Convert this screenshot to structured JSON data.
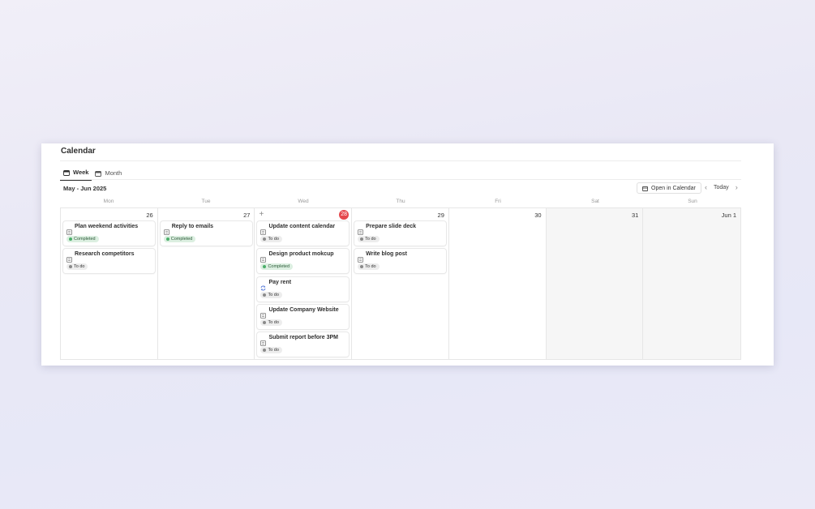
{
  "title": "Calendar",
  "tabs": [
    {
      "label": "Week",
      "icon": "calendar-icon",
      "active": true
    },
    {
      "label": "Month",
      "icon": "calendar-icon",
      "active": false
    }
  ],
  "range_label": "May - Jun 2025",
  "open_button": "Open in Calendar",
  "today_button": "Today",
  "weekdays": [
    "Mon",
    "Tue",
    "Wed",
    "Thu",
    "Fri",
    "Sat",
    "Sun"
  ],
  "days": [
    {
      "num": "26",
      "tasks": [
        {
          "name": "Plan weekend activities",
          "icon": "task-icon",
          "status": "Completed"
        },
        {
          "name": "Research competitors",
          "icon": "task-icon",
          "status": "To do"
        }
      ]
    },
    {
      "num": "27",
      "tasks": [
        {
          "name": "Reply to emails",
          "icon": "task-icon",
          "status": "Completed"
        }
      ]
    },
    {
      "num": "28",
      "today": true,
      "tasks": [
        {
          "name": "Update content calendar",
          "icon": "task-icon",
          "status": "To do"
        },
        {
          "name": "Design product mokcup",
          "icon": "task-icon",
          "status": "Completed"
        },
        {
          "name": "Pay rent",
          "icon": "repeat-icon",
          "status": "To do"
        },
        {
          "name": "Update Company Website",
          "icon": "task-icon",
          "status": "To do"
        },
        {
          "name": "Submit report before 3PM",
          "icon": "task-icon",
          "status": "To do"
        }
      ]
    },
    {
      "num": "29",
      "tasks": [
        {
          "name": "Prepare slide deck",
          "icon": "task-icon",
          "status": "To do"
        },
        {
          "name": "Write blog post",
          "icon": "task-icon",
          "status": "To do"
        }
      ]
    },
    {
      "num": "30",
      "tasks": []
    },
    {
      "num": "31",
      "tasks": []
    },
    {
      "num": "Jun 1",
      "tasks": []
    }
  ],
  "colors": {
    "today": "#e5484d",
    "completed": "#4caf6a",
    "todo": "#8a8a8a"
  }
}
